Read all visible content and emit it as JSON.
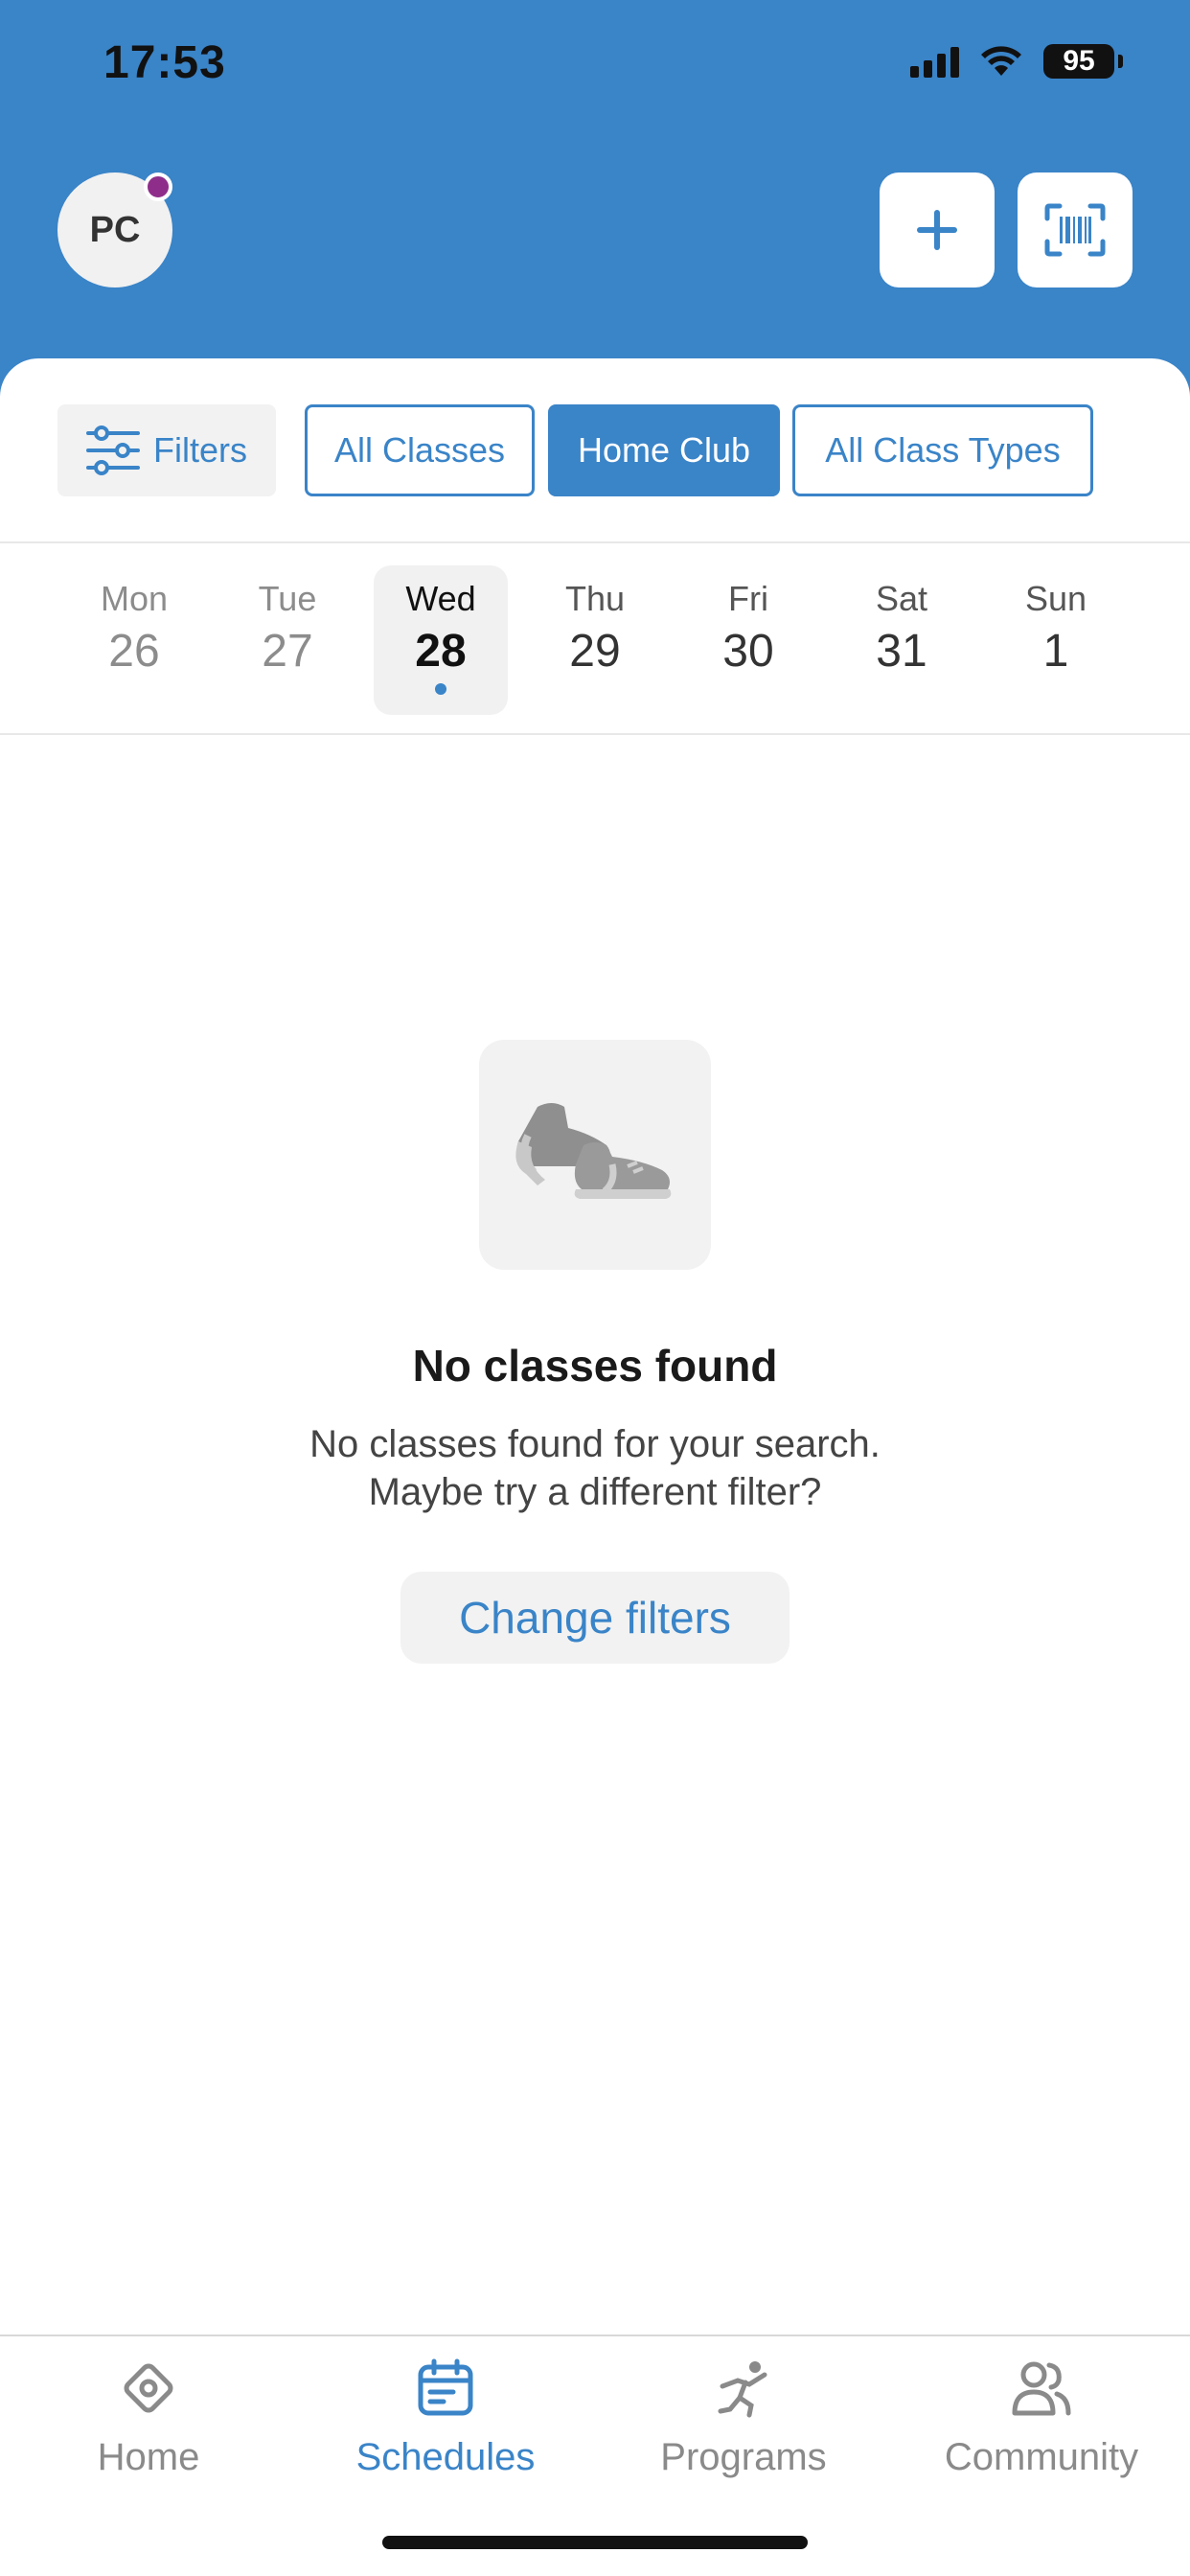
{
  "status_bar": {
    "time": "17:53",
    "battery": "95"
  },
  "header": {
    "avatar_initials": "PC",
    "add_icon": "plus-icon",
    "scan_icon": "barcode-scan-icon",
    "accent_color": "#3a84c8",
    "notification_dot_color": "#8e2e8a"
  },
  "filters": {
    "filters_label": "Filters",
    "chips": [
      {
        "label": "All Classes",
        "active": false
      },
      {
        "label": "Home Club",
        "active": true
      },
      {
        "label": "All Class Types",
        "active": false
      }
    ]
  },
  "days": [
    {
      "name": "Mon",
      "num": "26",
      "state": "past"
    },
    {
      "name": "Tue",
      "num": "27",
      "state": "past"
    },
    {
      "name": "Wed",
      "num": "28",
      "state": "selected"
    },
    {
      "name": "Thu",
      "num": "29",
      "state": "future"
    },
    {
      "name": "Fri",
      "num": "30",
      "state": "future"
    },
    {
      "name": "Sat",
      "num": "31",
      "state": "future"
    },
    {
      "name": "Sun",
      "num": "1",
      "state": "future"
    }
  ],
  "empty_state": {
    "icon": "sneakers-icon",
    "title": "No classes found",
    "line1": "No classes found for your search.",
    "line2": "Maybe try a different filter?",
    "button_label": "Change filters"
  },
  "tabbar": {
    "tabs": [
      {
        "label": "Home",
        "icon": "home-icon",
        "active": false
      },
      {
        "label": "Schedules",
        "icon": "calendar-icon",
        "active": true
      },
      {
        "label": "Programs",
        "icon": "running-icon",
        "active": false
      },
      {
        "label": "Community",
        "icon": "people-icon",
        "active": false
      }
    ]
  }
}
